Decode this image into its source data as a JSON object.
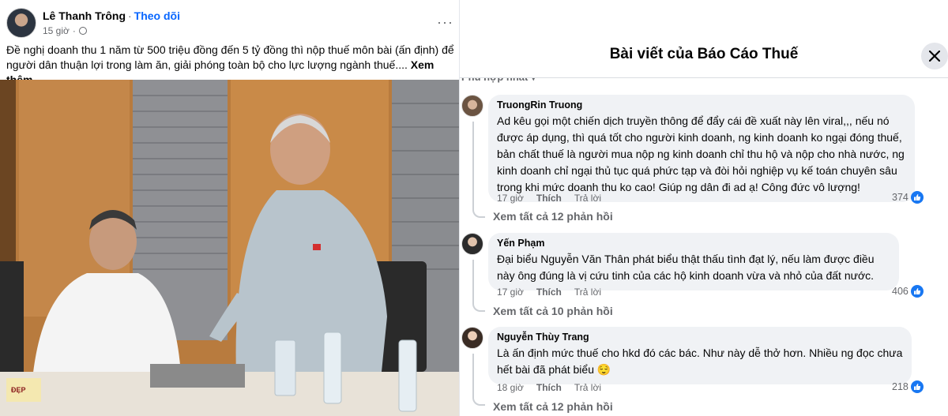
{
  "post": {
    "author": "Lê Thanh Trông",
    "follow_label": "Theo dõi",
    "time": "15 giờ",
    "text": "Đề nghị doanh thu 1 năm từ 500 triệu đồng đến 5 tỷ đồng thì nộp thuế môn bài (ấn định) để người dân thuận lợi trong làm ăn, giải phóng toàn bộ cho lực lượng ngành thuế....",
    "see_more": "Xem thêm",
    "more_icon": "more-horizontal-icon",
    "privacy_icon": "globe-icon",
    "photo_desc_icon": "photo",
    "nameplate_text": "ĐẸP"
  },
  "panel": {
    "title": "Bài viết của Báo Cáo Thuế",
    "sort_label": "Phù hợp nhất",
    "close_icon": "close-icon"
  },
  "comments": [
    {
      "name": "TruongRin Truong",
      "text": "Ad kêu gọi một chiến dịch truyền thông để đẩy cái đề xuất này lên viral,,, nếu nó được áp dụng, thì quá tốt cho người kinh doanh, ng kinh doanh ko ngại đóng thuế, bản chất thuế là người mua nộp ng kinh doanh chỉ thu hộ và nộp cho nhà nước, ng kinh doanh chỉ ngại thủ tục quá phức tạp và đòi hỏi nghiệp vụ kế toán chuyên sâu trong khi mức doanh thu ko cao! Giúp ng dân đi ad ạ! Công đức vô lượng!",
      "time": "17 giờ",
      "like": "Thích",
      "reply": "Trả lời",
      "reactions": "374",
      "view_replies": "Xem tất cả 12 phản hồi"
    },
    {
      "name": "Yến Phạm",
      "text": "Đại biểu Nguyễn Văn Thân phát biểu thật thấu tình đạt lý, nếu làm được điều này ông đúng là vị cứu tinh của các hộ kinh doanh vừa và nhỏ của đất nước.",
      "time": "17 giờ",
      "like": "Thích",
      "reply": "Trả lời",
      "reactions": "406",
      "view_replies": "Xem tất cả 10 phản hồi"
    },
    {
      "name": "Nguyễn Thùy Trang",
      "text": "Là ấn định mức thuế cho hkd đó các bác. Như này dễ thở hơn. Nhiều ng đọc chưa hết bài đã phát biểu 😌",
      "time": "18 giờ",
      "like": "Thích",
      "reply": "Trả lời",
      "reactions": "218",
      "view_replies": "Xem tất cả 12 phản hồi"
    }
  ],
  "colors": {
    "link_blue": "#0866ff",
    "like_blue": "#1877f2",
    "bubble_bg": "#f0f2f5",
    "muted_text": "#65676b"
  }
}
